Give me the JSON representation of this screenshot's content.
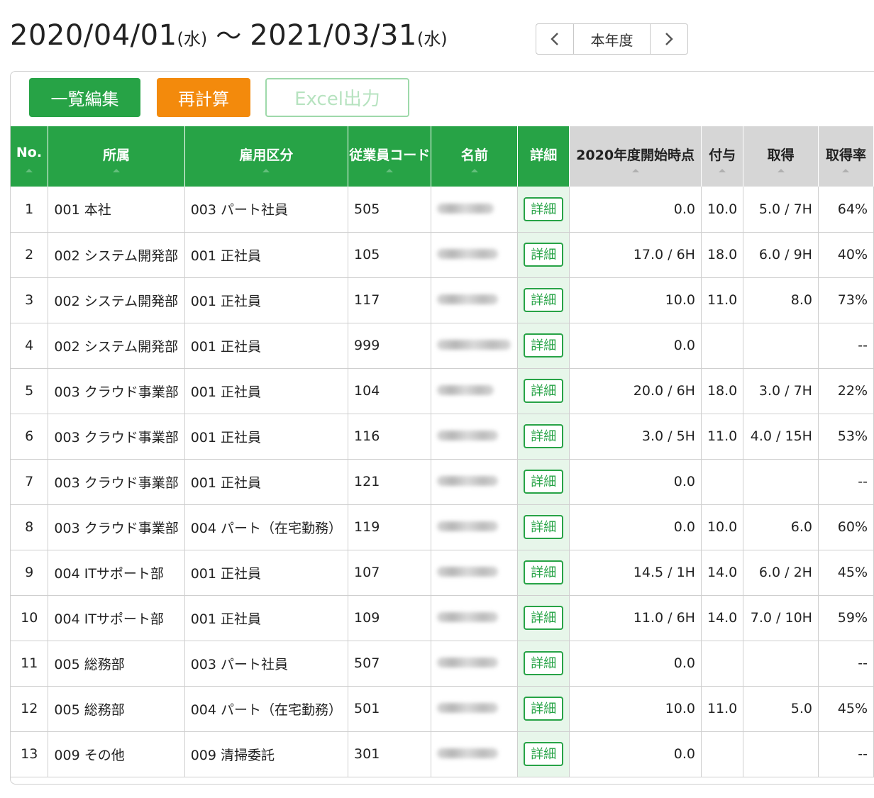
{
  "period": {
    "start_date": "2020/04/01",
    "start_dow": "(水)",
    "separator": "～",
    "end_date": "2021/03/31",
    "end_dow": "(水)",
    "nav_label": "本年度"
  },
  "toolbar": {
    "edit_list_label": "一覧編集",
    "recalc_label": "再計算",
    "excel_label": "Excel出力"
  },
  "table": {
    "headers": {
      "no": "No.",
      "dept": "所属",
      "emp_type": "雇用区分",
      "emp_code": "従業員コード",
      "name": "名前",
      "detail": "詳細",
      "start_balance": "2020年度開始時点",
      "granted": "付与",
      "taken": "取得",
      "rate": "取得率"
    },
    "detail_button_label": "詳細",
    "rows": [
      {
        "no": "1",
        "dept": "001 本社",
        "emp_type": "003 パート社員",
        "code": "505",
        "start_balance": "0.0",
        "granted": "10.0",
        "taken": "5.0 / 7H",
        "rate": "64%"
      },
      {
        "no": "2",
        "dept": "002 システム開発部",
        "emp_type": "001 正社員",
        "code": "105",
        "start_balance": "17.0 / 6H",
        "granted": "18.0",
        "taken": "6.0 / 9H",
        "rate": "40%"
      },
      {
        "no": "3",
        "dept": "002 システム開発部",
        "emp_type": "001 正社員",
        "code": "117",
        "start_balance": "10.0",
        "granted": "11.0",
        "taken": "8.0",
        "rate": "73%"
      },
      {
        "no": "4",
        "dept": "002 システム開発部",
        "emp_type": "001 正社員",
        "code": "999",
        "start_balance": "0.0",
        "granted": "",
        "taken": "",
        "rate": "--"
      },
      {
        "no": "5",
        "dept": "003 クラウド事業部",
        "emp_type": "001 正社員",
        "code": "104",
        "start_balance": "20.0 / 6H",
        "granted": "18.0",
        "taken": "3.0 / 7H",
        "rate": "22%"
      },
      {
        "no": "6",
        "dept": "003 クラウド事業部",
        "emp_type": "001 正社員",
        "code": "116",
        "start_balance": "3.0 / 5H",
        "granted": "11.0",
        "taken": "4.0 / 15H",
        "rate": "53%"
      },
      {
        "no": "7",
        "dept": "003 クラウド事業部",
        "emp_type": "001 正社員",
        "code": "121",
        "start_balance": "0.0",
        "granted": "",
        "taken": "",
        "rate": "--"
      },
      {
        "no": "8",
        "dept": "003 クラウド事業部",
        "emp_type": "004 パート（在宅勤務）",
        "code": "119",
        "start_balance": "0.0",
        "granted": "10.0",
        "taken": "6.0",
        "rate": "60%"
      },
      {
        "no": "9",
        "dept": "004 ITサポート部",
        "emp_type": "001 正社員",
        "code": "107",
        "start_balance": "14.5 / 1H",
        "granted": "14.0",
        "taken": "6.0 / 2H",
        "rate": "45%"
      },
      {
        "no": "10",
        "dept": "004 ITサポート部",
        "emp_type": "001 正社員",
        "code": "109",
        "start_balance": "11.0 / 6H",
        "granted": "14.0",
        "taken": "7.0 / 10H",
        "rate": "59%"
      },
      {
        "no": "11",
        "dept": "005 総務部",
        "emp_type": "003 パート社員",
        "code": "507",
        "start_balance": "0.0",
        "granted": "",
        "taken": "",
        "rate": "--"
      },
      {
        "no": "12",
        "dept": "005 総務部",
        "emp_type": "004 パート（在宅勤務）",
        "code": "501",
        "start_balance": "10.0",
        "granted": "11.0",
        "taken": "5.0",
        "rate": "45%"
      },
      {
        "no": "13",
        "dept": "009 その他",
        "emp_type": "009 清掃委託",
        "code": "301",
        "start_balance": "0.0",
        "granted": "",
        "taken": "",
        "rate": "--"
      }
    ]
  },
  "colors": {
    "accent_green": "#27a346",
    "accent_orange": "#f38a0c",
    "detail_column_bg": "#e7f6ea",
    "gray_header": "#d6d6d6"
  },
  "icons": {
    "prev": "chevron-left-icon",
    "next": "chevron-right-icon",
    "sort": "sort-caret-icon"
  }
}
